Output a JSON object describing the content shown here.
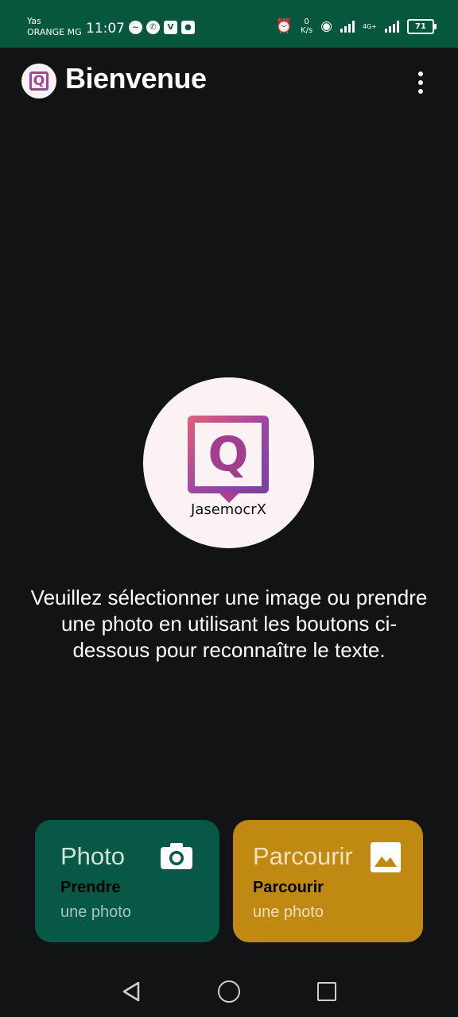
{
  "status_bar": {
    "carrier_line1": "Yas",
    "carrier_line2": "ORANGE MG",
    "time": "11:07",
    "speed_value": "0",
    "speed_unit": "K/s",
    "battery": "71",
    "network_label": "4G+",
    "icons_left": [
      "messenger-icon",
      "whatsapp-icon",
      "v-app-icon",
      "app-icon"
    ],
    "icons_right": [
      "alarm-icon",
      "hotspot-icon",
      "signal-icon",
      "signal-icon",
      "battery-icon"
    ]
  },
  "app_bar": {
    "title": "Bienvenue",
    "logo_letter": "Q",
    "menu_icon": "more-vert-icon"
  },
  "logo": {
    "letter": "Q",
    "brand": "JasemocrX",
    "colors": {
      "gradient_start": "#e35f78",
      "gradient_end": "#7b3f9e"
    }
  },
  "instructions": "Veuillez sélectionner une image ou prendre une photo en utilisant les boutons ci-dessous pour reconnaître le texte.",
  "actions": {
    "photo": {
      "title": "Photo",
      "line1": "Prendre",
      "line2": "une photo",
      "icon": "camera-icon",
      "color": "#075844"
    },
    "browse": {
      "title": "Parcourir",
      "line1": "Parcourir",
      "line2": "une photo",
      "icon": "image-icon",
      "color": "#bf8912"
    }
  },
  "nav_bar": {
    "buttons": [
      "back-icon",
      "home-icon",
      "recents-icon"
    ]
  }
}
